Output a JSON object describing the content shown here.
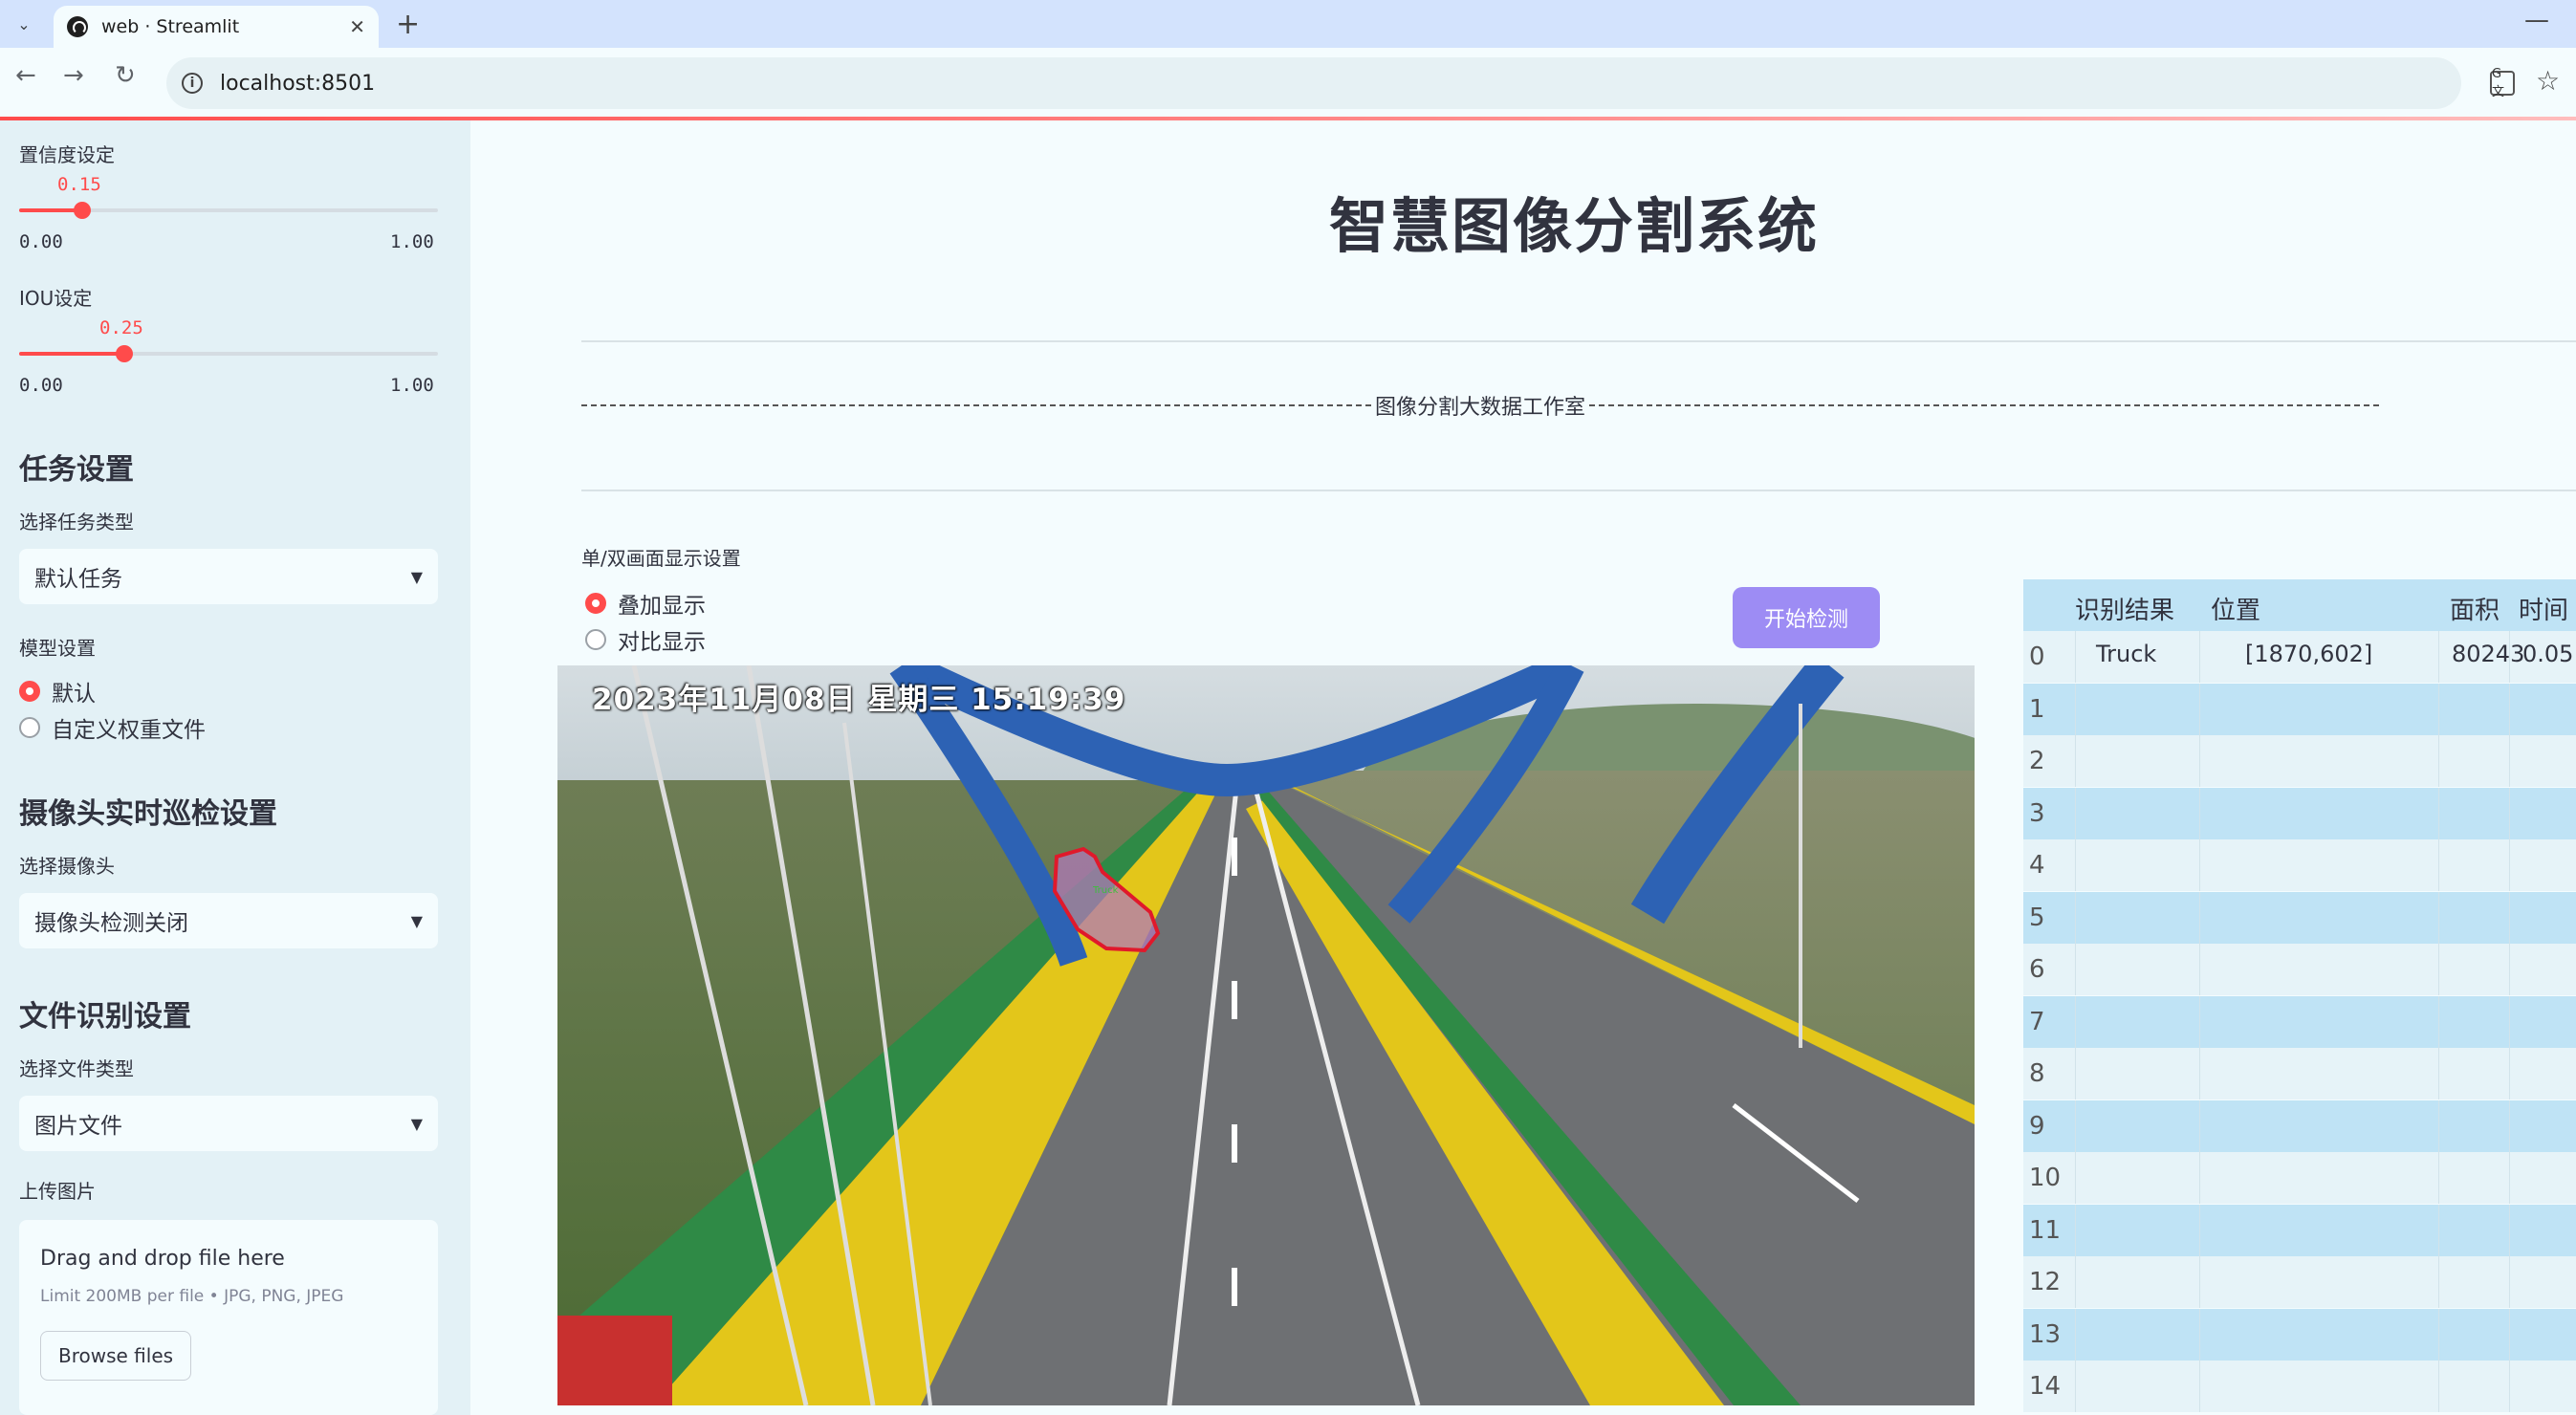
{
  "browser": {
    "tab_title": "web · Streamlit",
    "url": "localhost:8501"
  },
  "sidebar": {
    "confidence": {
      "label": "置信度设定",
      "value": "0.15",
      "min": "0.00",
      "max": "1.00",
      "fraction": 0.15
    },
    "iou": {
      "label": "IOU设定",
      "value": "0.25",
      "min": "0.00",
      "max": "1.00",
      "fraction": 0.25
    },
    "task_heading": "任务设置",
    "task_type_label": "选择任务类型",
    "task_type_value": "默认任务",
    "model_label": "模型设置",
    "model_options": [
      "默认",
      "自定义权重文件"
    ],
    "model_selected": 0,
    "camera_heading": "摄像头实时巡检设置",
    "camera_label": "选择摄像头",
    "camera_value": "摄像头检测关闭",
    "file_heading": "文件识别设置",
    "file_type_label": "选择文件类型",
    "file_type_value": "图片文件",
    "upload_label": "上传图片",
    "upload_title": "Drag and drop file here",
    "upload_limit": "Limit 200MB per file • JPG, PNG, JPEG",
    "browse_label": "Browse files"
  },
  "main": {
    "title": "智慧图像分割系统",
    "studio": "图像分割大数据工作室",
    "display_label": "单/双画面显示设置",
    "display_options": [
      "叠加显示",
      "对比显示"
    ],
    "display_selected": 0,
    "start_button": "开始检测",
    "video_stamp_date": "2023年11月08日",
    "video_stamp_day": "星期三",
    "video_stamp_time": "15:19:39",
    "detection_label": "Truck"
  },
  "table": {
    "headers": [
      "识别结果",
      "位置",
      "面积",
      "时间"
    ],
    "rows": [
      {
        "index": "0",
        "result": "Truck",
        "position": "[1870,602]",
        "area": "80243",
        "time": "0.05"
      },
      {
        "index": "1"
      },
      {
        "index": "2"
      },
      {
        "index": "3"
      },
      {
        "index": "4"
      },
      {
        "index": "5"
      },
      {
        "index": "6"
      },
      {
        "index": "7"
      },
      {
        "index": "8"
      },
      {
        "index": "9"
      },
      {
        "index": "10"
      },
      {
        "index": "11"
      },
      {
        "index": "12"
      },
      {
        "index": "13"
      },
      {
        "index": "14"
      }
    ]
  },
  "colors": {
    "accent": "#ff4b4b",
    "button": "#9d8cf4",
    "sidebar": "#e3f1f6",
    "table_header": "#bfe3f5"
  }
}
